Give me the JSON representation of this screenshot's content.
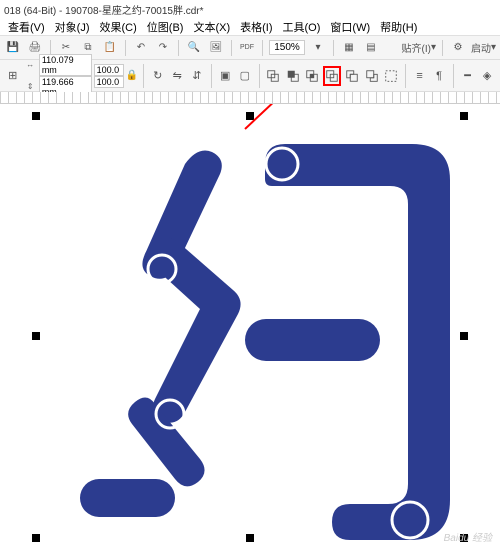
{
  "titlebar": {
    "text": "018 (64-Bit) - 190708-星座之约-70015胖.cdr*"
  },
  "menubar": {
    "items": [
      {
        "label": "查看(V)"
      },
      {
        "label": "对象(J)"
      },
      {
        "label": "效果(C)"
      },
      {
        "label": "位图(B)"
      },
      {
        "label": "文本(X)"
      },
      {
        "label": "表格(I)"
      },
      {
        "label": "工具(O)"
      },
      {
        "label": "窗口(W)"
      },
      {
        "label": "帮助(H)"
      }
    ]
  },
  "toolbar1": {
    "export_label": "PDF",
    "zoom_value": "150%",
    "snap_label": "贴齐(I)",
    "launch_label": "启动"
  },
  "toolbar2": {
    "width_label": "↔",
    "width_value": "110.079 mm",
    "height_label": "⇕",
    "height_value": "119.666 mm",
    "scale_x": "100.0",
    "scale_y": "100.0"
  },
  "artwork": {
    "fill": "#2c3c8f"
  },
  "selection": {
    "handles": 8
  }
}
